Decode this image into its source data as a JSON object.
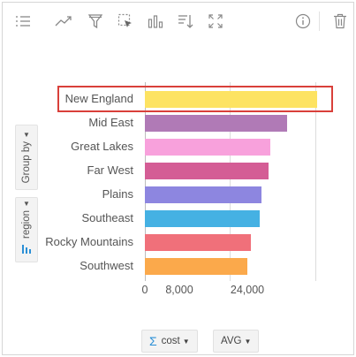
{
  "toolbar": {
    "icons": [
      "list-icon",
      "trend-icon",
      "filter-icon",
      "select-icon",
      "chart-type-icon",
      "sort-icon",
      "expand-icon",
      "info-icon",
      "trash-icon"
    ]
  },
  "side": {
    "group_by_label": "Group by",
    "region_label": "region"
  },
  "chart_data": {
    "type": "bar",
    "orientation": "horizontal",
    "categories": [
      "New England",
      "Mid East",
      "Great Lakes",
      "Far West",
      "Plains",
      "Southeast",
      "Rocky Mountains",
      "Southwest"
    ],
    "values": [
      40500,
      33500,
      29500,
      29000,
      27500,
      27000,
      25000,
      24000
    ],
    "colors": [
      "#fde362",
      "#b07ab6",
      "#f8a1dc",
      "#d45d95",
      "#8d86e0",
      "#45b1e3",
      "#f0707a",
      "#fba94b"
    ],
    "x_ticks": [
      "0",
      "8,000",
      "24,000"
    ],
    "x_tick_values": [
      0,
      8000,
      24000
    ],
    "xlim": [
      0,
      43000
    ],
    "gridlines_at": [
      0,
      20000,
      40000
    ],
    "highlighted_category": "New England",
    "highlight_color": "#d9403a"
  },
  "footer": {
    "measure_label": "cost",
    "aggregation_label": "AVG"
  }
}
